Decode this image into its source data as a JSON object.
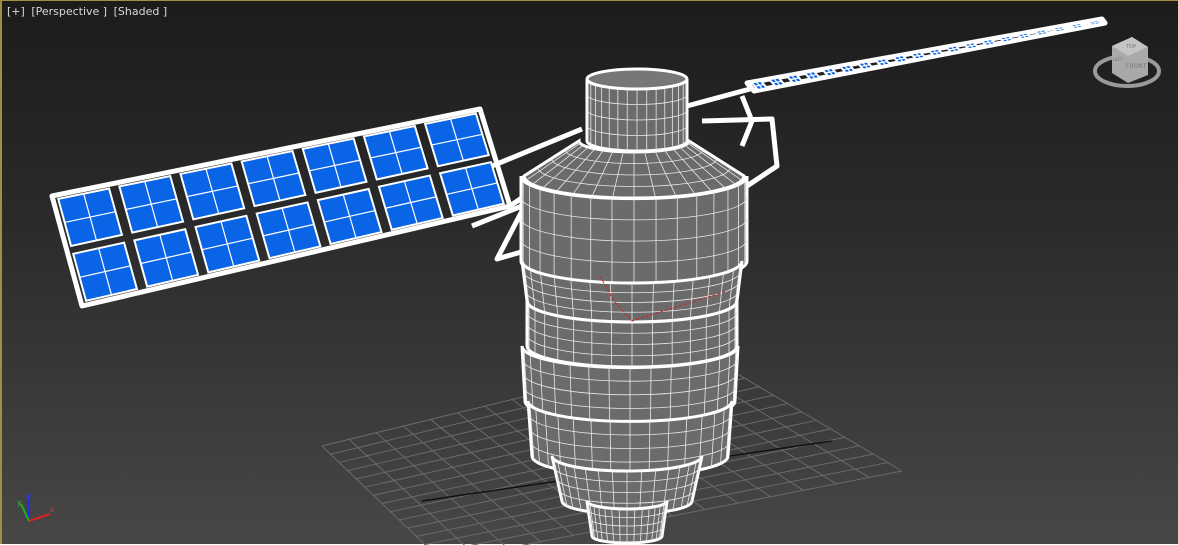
{
  "viewport": {
    "labels": {
      "plus": "[+]",
      "view": "[Perspective ]",
      "shading": "[Shaded ]"
    },
    "viewcube": {
      "top_face": "TOP",
      "front_face": "FRONT",
      "left_face": "LEFT"
    },
    "axis_tripod": {
      "x": "x",
      "y": "y",
      "z": "z"
    },
    "colors": {
      "panel_cell": "#0a64e6",
      "wire": "#ffffff",
      "border_active": "#a48d3c",
      "x_axis": "#e02020",
      "y_axis": "#20b020",
      "z_axis": "#2030e0"
    }
  }
}
